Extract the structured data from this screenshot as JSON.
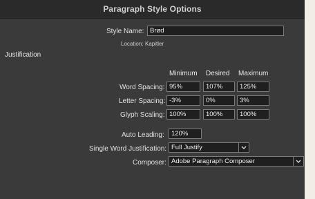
{
  "dialog": {
    "title": "Paragraph Style Options"
  },
  "style": {
    "name_label": "Style Name:",
    "name_value": "Brød",
    "location_label": "Location:",
    "location_value": "Kapitler"
  },
  "justification": {
    "section_label": "Justification",
    "columns": {
      "minimum": "Minimum",
      "desired": "Desired",
      "maximum": "Maximum"
    },
    "rows": {
      "word_spacing": {
        "label": "Word Spacing:",
        "min": "95%",
        "des": "107%",
        "max": "125%"
      },
      "letter_spacing": {
        "label": "Letter Spacing:",
        "min": "-3%",
        "des": "0%",
        "max": "3%"
      },
      "glyph_scaling": {
        "label": "Glyph Scaling:",
        "min": "100%",
        "des": "100%",
        "max": "100%"
      }
    },
    "auto_leading": {
      "label": "Auto Leading:",
      "value": "120%"
    },
    "single_word": {
      "label": "Single Word Justification:",
      "value": "Full Justify"
    },
    "composer": {
      "label": "Composer:",
      "value": "Adobe Paragraph Composer"
    }
  },
  "icons": {
    "dropdown": "chevron-down-icon"
  }
}
